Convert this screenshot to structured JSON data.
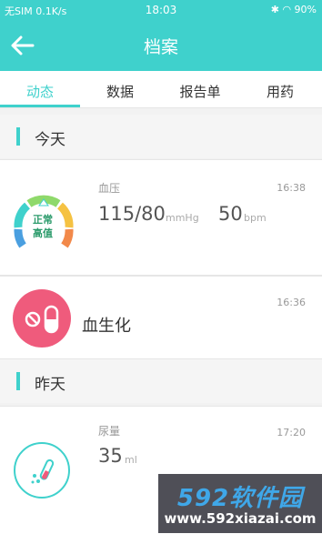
{
  "status_bar": {
    "left": "无SIM 0.1K/s",
    "time": "18:03",
    "right": "90%"
  },
  "nav": {
    "title": "档案"
  },
  "tabs": [
    {
      "label": "动态",
      "active": true
    },
    {
      "label": "数据",
      "active": false
    },
    {
      "label": "报告单",
      "active": false
    },
    {
      "label": "用药",
      "active": false
    }
  ],
  "sections": {
    "today": "今天",
    "yesterday": "昨天"
  },
  "records": {
    "blood_pressure": {
      "label": "血压",
      "time": "16:38",
      "gauge_text_1": "正常",
      "gauge_text_2": "高值",
      "bp_value": "115/80",
      "bp_unit": "mmHg",
      "pulse_value": "50",
      "pulse_unit": "bpm"
    },
    "biochem": {
      "label": "血生化",
      "time": "16:36"
    },
    "urine": {
      "label": "尿量",
      "time": "17:20",
      "value": "35",
      "unit": "ml"
    }
  },
  "watermark": {
    "brand": "592软件园",
    "url": "www.592xiazai.com"
  },
  "colors": {
    "accent": "#3fd1cc",
    "pink": "#ef5b7c"
  }
}
